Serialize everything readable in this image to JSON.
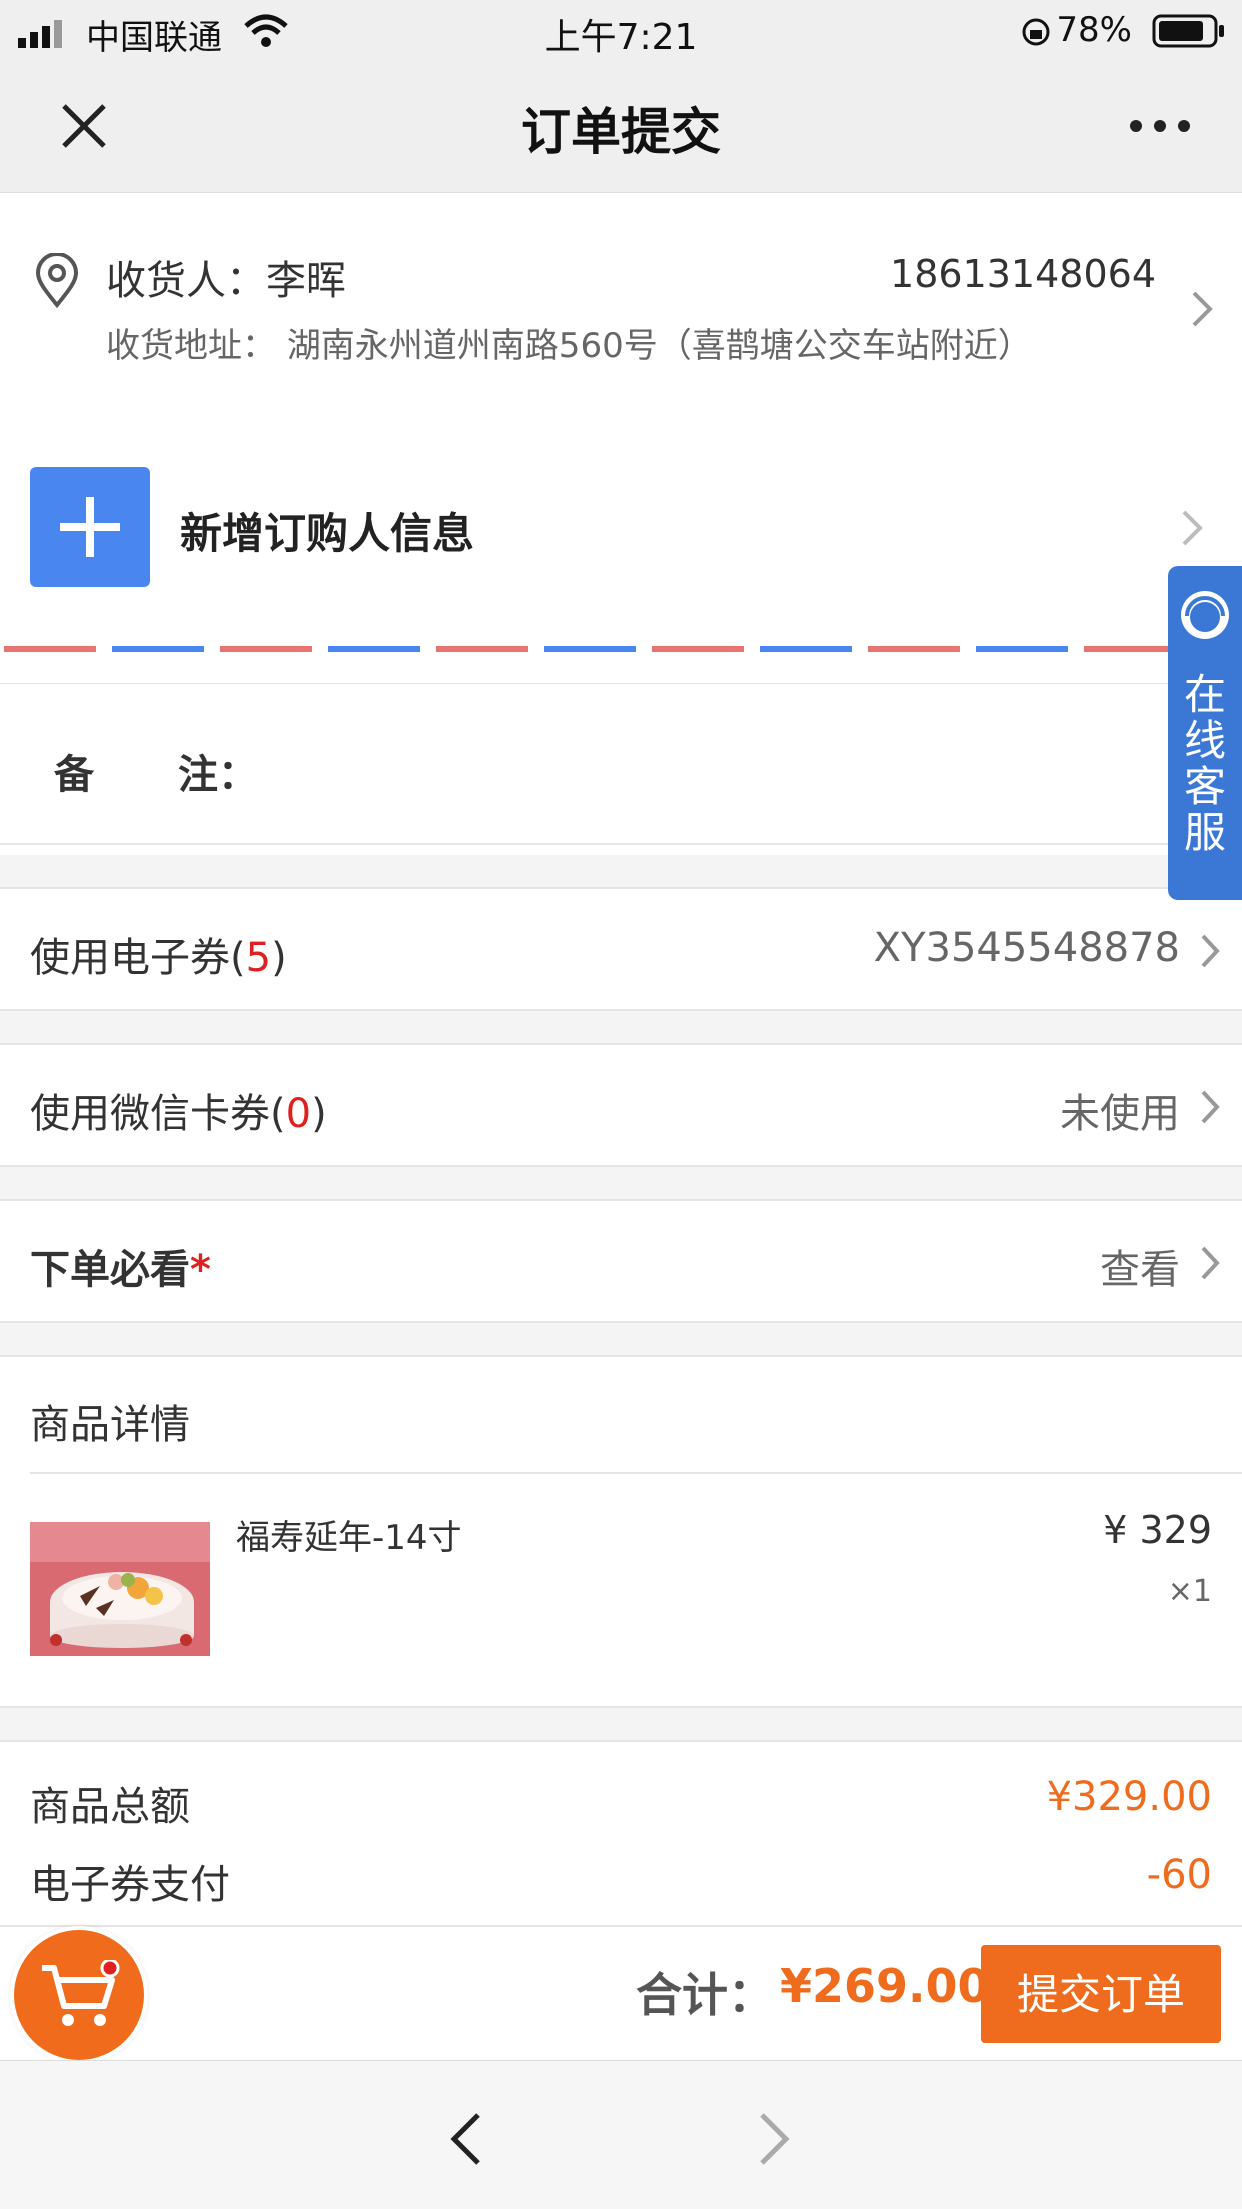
{
  "status_bar": {
    "carrier": "中国联通",
    "time": "上午7:21",
    "battery": "78%"
  },
  "nav": {
    "title": "订单提交"
  },
  "address": {
    "name_label": "收货人：李晖",
    "phone": "18613148064",
    "address_label": "收货地址：",
    "address": "湖南永州道州南路560号（喜鹊塘公交车站附近）"
  },
  "new_buyer": {
    "label": "新增订购人信息"
  },
  "remark": {
    "label_a": "备",
    "label_b": "注："
  },
  "coupon": {
    "label": "使用电子券",
    "count": "5",
    "value": "XY3545548878"
  },
  "wechat_coupon": {
    "label": "使用微信卡券",
    "count": "0",
    "value": "未使用"
  },
  "notice": {
    "label": "下单必看",
    "star": "*",
    "value": "查看"
  },
  "product_section": {
    "title": "商品详情",
    "items": [
      {
        "name": "福寿延年-14寸",
        "price": "¥ 329",
        "qty": "×1"
      }
    ]
  },
  "summary": {
    "total_label": "商品总额",
    "total_value": "¥329.00",
    "coupon_label": "电子券支付",
    "coupon_value": "-60"
  },
  "bottom": {
    "sum_label": "合计：",
    "sum_value": "¥269.00",
    "submit_label": "提交订单"
  },
  "customer_service": {
    "label": "在线客服"
  },
  "colors": {
    "accent_blue": "#4a86f0",
    "accent_orange": "#ef6c1f",
    "badge_red": "#e02020"
  }
}
